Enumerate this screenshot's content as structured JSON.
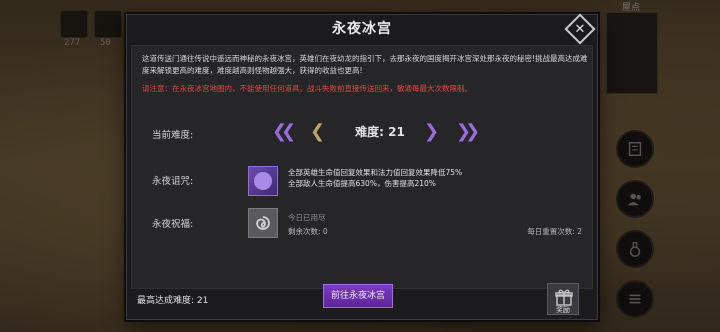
{
  "background": {
    "slot_values": [
      "277",
      "50"
    ],
    "minimap_label": "屋点"
  },
  "dialog": {
    "title": "永夜冰宫",
    "description": "这道传送门通往传说中遥远而神秘的永夜冰宫，英雄们在夜幼龙的指引下，去那永夜的国度揭开冰宫深处那永夜的秘密!挑战最高达成难度来解锁更高的难度，难度越高则怪物越强大，获得的收益也更高!",
    "warning": "请注意：在永夜冰宫地图内，不能使用任何道具。战斗失败前直接传送回来，敏通每最大次数限制。",
    "difficulty": {
      "label": "当前难度:",
      "value_text": "难度: 21"
    },
    "curse": {
      "label": "永夜诅咒:",
      "icon": "purple-curse-face-icon",
      "lines": [
        "全部英雄生命值回复效果和法力值回复效果降低75%",
        "全部敌人生命值提高630%，伤害提高210%"
      ]
    },
    "blessing": {
      "label": "永夜祝福:",
      "icon": "swirl-icon",
      "status": "今日已用尽",
      "remaining": "剩余次数: 0",
      "daily_reset": "每日重置次数: 2"
    },
    "best_difficulty": "最高达成难度: 21",
    "go_button": "前往永夜冰宫",
    "reward_label": "奖励"
  },
  "colors": {
    "accent_purple": "#9b6be0",
    "warning_red": "#e04646",
    "arrow_gold": "#bfa36c"
  }
}
